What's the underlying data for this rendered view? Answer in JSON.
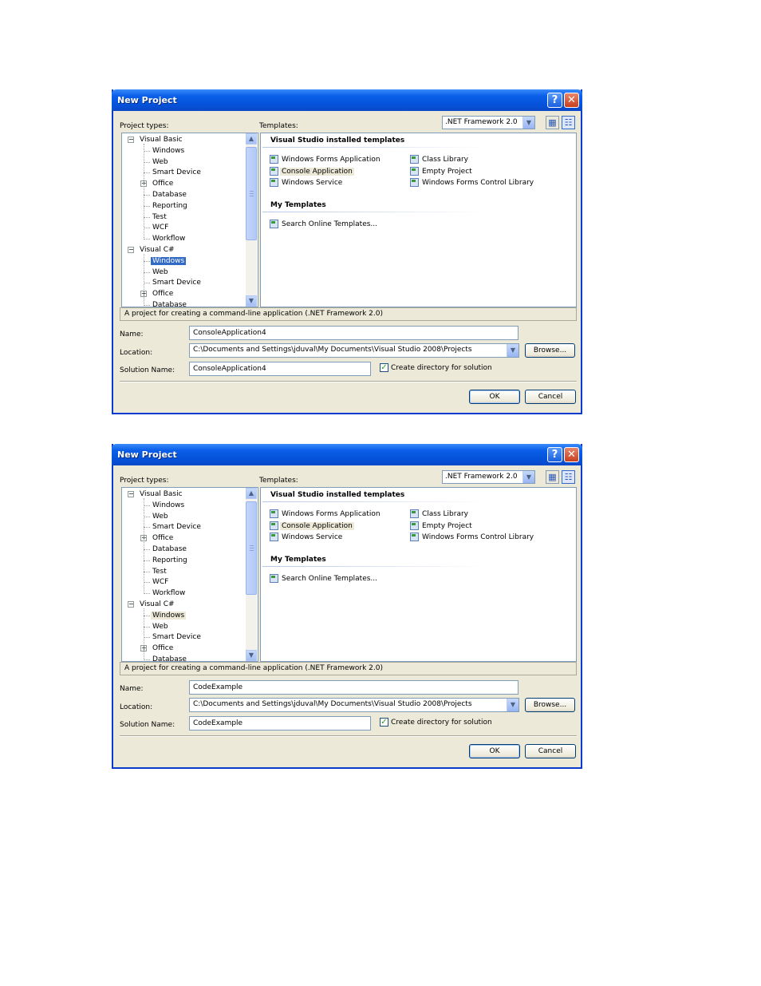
{
  "dialogs": [
    {
      "title": "New Project",
      "project_types_label": "Project types:",
      "templates_label": "Templates:",
      "framework": ".NET Framework 2.0",
      "tree": [
        {
          "label": "Visual Basic",
          "level": 0,
          "expander": "−"
        },
        {
          "label": "Windows",
          "level": 1
        },
        {
          "label": "Web",
          "level": 1
        },
        {
          "label": "Smart Device",
          "level": 1
        },
        {
          "label": "Office",
          "level": 1,
          "expander": "+"
        },
        {
          "label": "Database",
          "level": 1
        },
        {
          "label": "Reporting",
          "level": 1
        },
        {
          "label": "Test",
          "level": 1
        },
        {
          "label": "WCF",
          "level": 1
        },
        {
          "label": "Workflow",
          "level": 1
        },
        {
          "label": "Visual C#",
          "level": 0,
          "expander": "−"
        },
        {
          "label": "Windows",
          "level": 1,
          "state": "selected"
        },
        {
          "label": "Web",
          "level": 1
        },
        {
          "label": "Smart Device",
          "level": 1
        },
        {
          "label": "Office",
          "level": 1,
          "expander": "+"
        },
        {
          "label": "Database",
          "level": 1
        }
      ],
      "installed_header": "Visual Studio installed templates",
      "installed_left": [
        "Windows Forms Application",
        "Console Application",
        "Windows Service"
      ],
      "installed_right": [
        "Class Library",
        "Empty Project",
        "Windows Forms Control Library"
      ],
      "highlighted_template": "Console Application",
      "my_templates_header": "My Templates",
      "my_templates": [
        "Search Online Templates..."
      ],
      "description": "A project for creating a command-line application (.NET Framework 2.0)",
      "name_label": "Name:",
      "name_value": "ConsoleApplication4",
      "location_label": "Location:",
      "location_value": "C:\\Documents and Settings\\jduval\\My Documents\\Visual Studio 2008\\Projects",
      "browse_label": "Browse...",
      "solution_label": "Solution Name:",
      "solution_value": "ConsoleApplication4",
      "create_dir_label": "Create directory for solution",
      "create_dir_checked": true,
      "ok_label": "OK",
      "cancel_label": "Cancel"
    },
    {
      "title": "New Project",
      "project_types_label": "Project types:",
      "templates_label": "Templates:",
      "framework": ".NET Framework 2.0",
      "tree": [
        {
          "label": "Visual Basic",
          "level": 0,
          "expander": "−"
        },
        {
          "label": "Windows",
          "level": 1
        },
        {
          "label": "Web",
          "level": 1
        },
        {
          "label": "Smart Device",
          "level": 1
        },
        {
          "label": "Office",
          "level": 1,
          "expander": "+"
        },
        {
          "label": "Database",
          "level": 1
        },
        {
          "label": "Reporting",
          "level": 1
        },
        {
          "label": "Test",
          "level": 1
        },
        {
          "label": "WCF",
          "level": 1
        },
        {
          "label": "Workflow",
          "level": 1
        },
        {
          "label": "Visual C#",
          "level": 0,
          "expander": "−"
        },
        {
          "label": "Windows",
          "level": 1,
          "state": "inactive"
        },
        {
          "label": "Web",
          "level": 1
        },
        {
          "label": "Smart Device",
          "level": 1
        },
        {
          "label": "Office",
          "level": 1,
          "expander": "+"
        },
        {
          "label": "Database",
          "level": 1
        }
      ],
      "installed_header": "Visual Studio installed templates",
      "installed_left": [
        "Windows Forms Application",
        "Console Application",
        "Windows Service"
      ],
      "installed_right": [
        "Class Library",
        "Empty Project",
        "Windows Forms Control Library"
      ],
      "highlighted_template": "Console Application",
      "my_templates_header": "My Templates",
      "my_templates": [
        "Search Online Templates..."
      ],
      "description": "A project for creating a command-line application (.NET Framework 2.0)",
      "name_label": "Name:",
      "name_value": "CodeExample",
      "location_label": "Location:",
      "location_value": "C:\\Documents and Settings\\jduval\\My Documents\\Visual Studio 2008\\Projects",
      "browse_label": "Browse...",
      "solution_label": "Solution Name:",
      "solution_value": "CodeExample",
      "create_dir_label": "Create directory for solution",
      "create_dir_checked": true,
      "ok_label": "OK",
      "cancel_label": "Cancel"
    }
  ],
  "colors": {
    "titlebar": "#0552da",
    "dialog_face": "#ece9d8",
    "selection": "#316ac5"
  }
}
